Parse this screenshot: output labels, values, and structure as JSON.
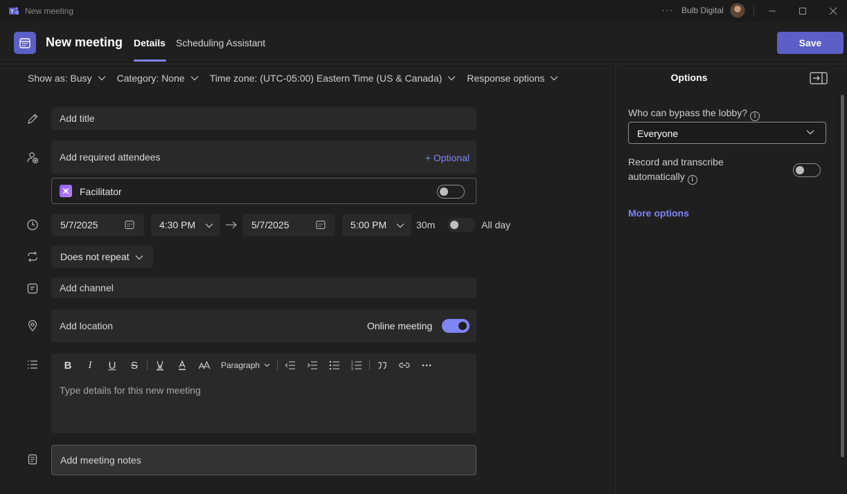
{
  "window": {
    "title": "New meeting",
    "more": "···",
    "org": "Bulb Digital"
  },
  "header": {
    "title": "New meeting",
    "tabs": [
      {
        "label": "Details"
      },
      {
        "label": "Scheduling Assistant"
      }
    ],
    "save_label": "Save"
  },
  "options_bar": {
    "show_as": "Show as: Busy",
    "category": "Category: None",
    "time_zone": "Time zone: (UTC-05:00) Eastern Time (US & Canada)",
    "response": "Response options"
  },
  "form": {
    "title_placeholder": "Add title",
    "attendees_placeholder": "Add required attendees",
    "optional_label": "+ Optional",
    "facilitator_label": "Facilitator",
    "facilitator_on": false,
    "start_date": "5/7/2025",
    "start_time": "4:30 PM",
    "end_date": "5/7/2025",
    "end_time": "5:00 PM",
    "duration": "30m",
    "all_day_label": "All day",
    "all_day_on": false,
    "repeat": "Does not repeat",
    "channel_placeholder": "Add channel",
    "location_placeholder": "Add location",
    "online_meeting_label": "Online meeting",
    "online_meeting_on": true,
    "editor": {
      "paragraph_label": "Paragraph",
      "placeholder": "Type details for this new meeting"
    },
    "notes_placeholder": "Add meeting notes"
  },
  "options_pane": {
    "title": "Options",
    "lobby_label": "Who can bypass the lobby?",
    "lobby_value": "Everyone",
    "record_label_line1": "Record and transcribe",
    "record_label_line2": "automatically",
    "record_on": false,
    "more_options": "More options"
  },
  "colors": {
    "accent": "#5b5fc7",
    "accent_light": "#7f85f5",
    "background": "#1f1f1f",
    "field": "#292929"
  }
}
